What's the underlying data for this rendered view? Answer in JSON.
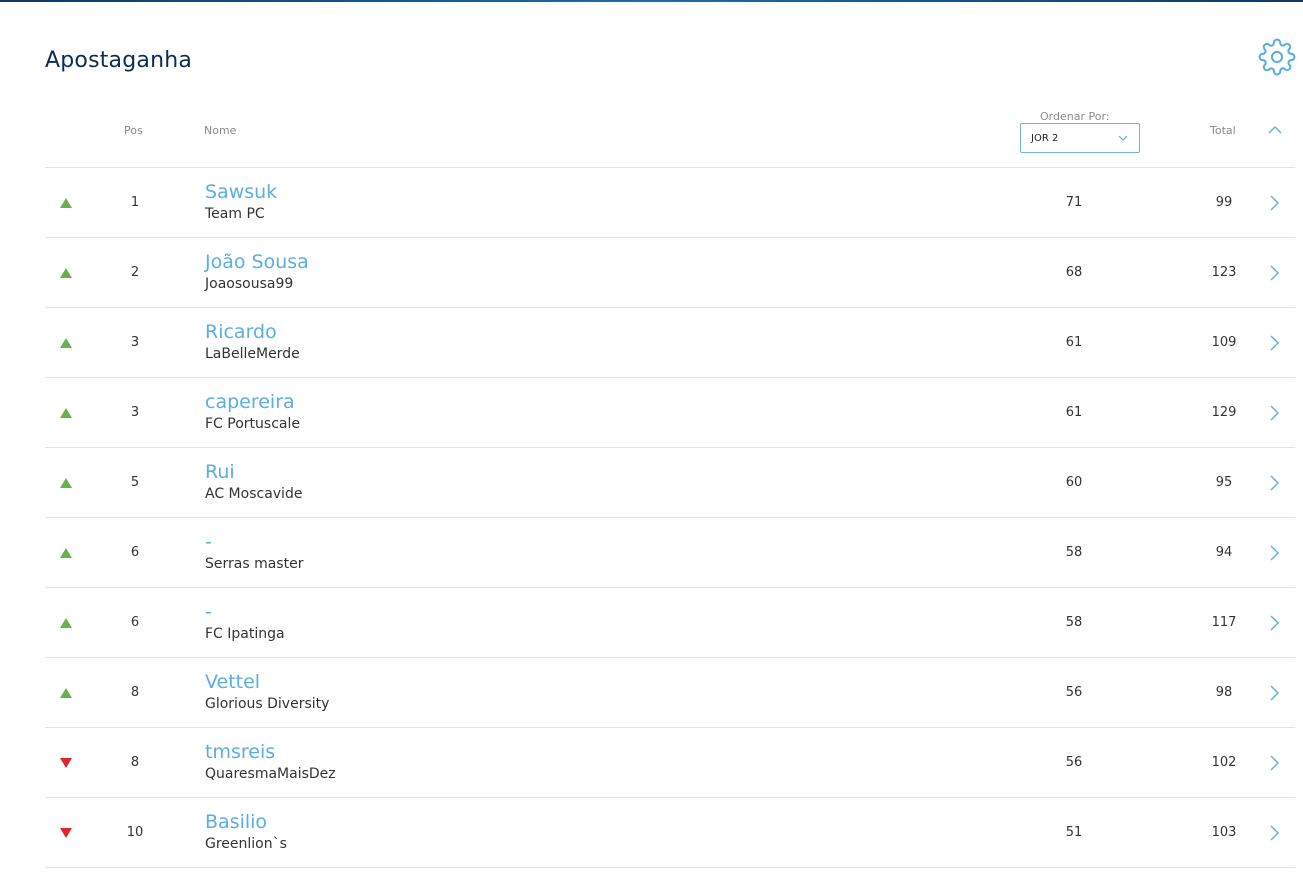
{
  "app": {
    "title": "Apostaganha"
  },
  "colors": {
    "accent": "#5aaee0",
    "title": "#0b2d55",
    "up": "#6ab04c",
    "down": "#e0262b"
  },
  "header": {
    "pos": "Pos",
    "nome": "Nome",
    "sort_label": "Ordenar Por:",
    "sort_value": "JOR 2",
    "total": "Total"
  },
  "rows": [
    {
      "trend": "up",
      "pos": "1",
      "name": "Sawsuk",
      "team": "Team PC",
      "jor": "71",
      "total": "99"
    },
    {
      "trend": "up",
      "pos": "2",
      "name": "João Sousa",
      "team": "Joaosousa99",
      "jor": "68",
      "total": "123"
    },
    {
      "trend": "up",
      "pos": "3",
      "name": "Ricardo",
      "team": "LaBelleMerde",
      "jor": "61",
      "total": "109"
    },
    {
      "trend": "up",
      "pos": "3",
      "name": "capereira",
      "team": "FC Portuscale",
      "jor": "61",
      "total": "129"
    },
    {
      "trend": "up",
      "pos": "5",
      "name": "Rui",
      "team": "AC Moscavide",
      "jor": "60",
      "total": "95"
    },
    {
      "trend": "up",
      "pos": "6",
      "name": "-",
      "team": "Serras master",
      "jor": "58",
      "total": "94"
    },
    {
      "trend": "up",
      "pos": "6",
      "name": "-",
      "team": "FC Ipatinga",
      "jor": "58",
      "total": "117"
    },
    {
      "trend": "up",
      "pos": "8",
      "name": "Vettel",
      "team": "Glorious Diversity",
      "jor": "56",
      "total": "98"
    },
    {
      "trend": "down",
      "pos": "8",
      "name": "tmsreis",
      "team": "QuaresmaMaisDez",
      "jor": "56",
      "total": "102"
    },
    {
      "trend": "down",
      "pos": "10",
      "name": "Basilio",
      "team": "Greenlion`s",
      "jor": "51",
      "total": "103"
    }
  ]
}
